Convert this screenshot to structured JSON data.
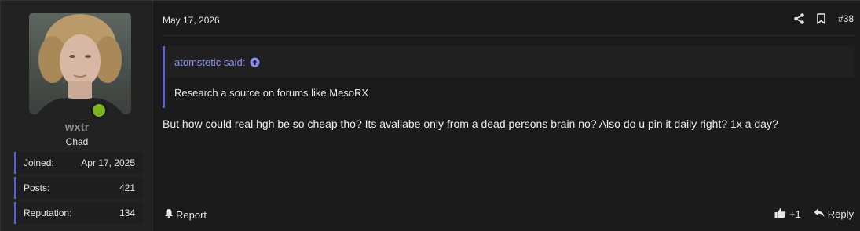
{
  "user": {
    "name": "wxtr",
    "title": "Chad",
    "online": true,
    "stats": [
      {
        "label": "Joined:",
        "value": "Apr 17, 2025"
      },
      {
        "label": "Posts:",
        "value": "421"
      },
      {
        "label": "Reputation:",
        "value": "134"
      }
    ]
  },
  "post": {
    "date": "May 17, 2026",
    "number": "#38",
    "quote": {
      "author": "atomstetic said:",
      "text": "Research a source on forums like MesoRX"
    },
    "message": "But how could real hgh be so cheap tho? Its avaliabe only from a dead persons brain no? Also do u pin it daily right? 1x a day?"
  },
  "footer": {
    "report_label": "Report",
    "like_count": "+1",
    "reply_label": "Reply"
  },
  "icons": {
    "share": "share-icon",
    "bookmark": "bookmark-icon",
    "quote_arrow": "arrow-up-circle-icon",
    "report": "bell-icon",
    "like": "thumbs-up-icon",
    "reply": "reply-icon"
  },
  "colors": {
    "accent": "#5c64c8",
    "quote_author": "#8a8ef0",
    "online": "#7fb51f",
    "background": "#1b1b1b",
    "sidebar": "#222222"
  }
}
